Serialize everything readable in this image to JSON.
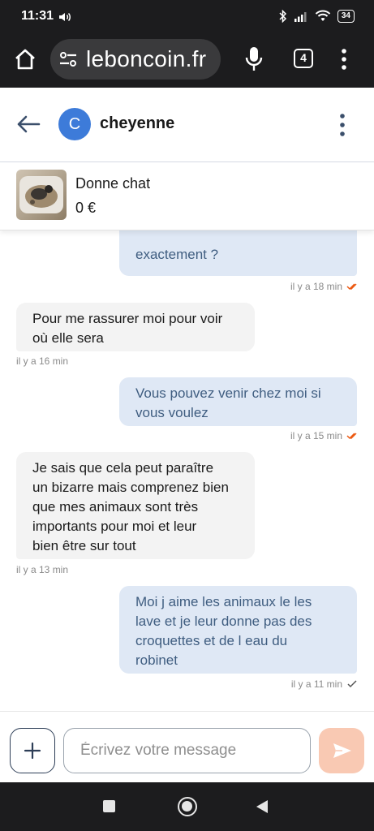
{
  "status_bar": {
    "time": "11:31",
    "battery": "34"
  },
  "browser": {
    "url": "leboncoin.fr",
    "tab_count": "4"
  },
  "header": {
    "avatar_letter": "C",
    "contact_name": "cheyenne"
  },
  "listing": {
    "title": "Donne chat",
    "price": "0 €"
  },
  "messages": [
    {
      "from": "me",
      "lines": [
        "exactement ?"
      ],
      "time": "il y a 18 min",
      "status": "read"
    },
    {
      "from": "them",
      "lines": [
        "Pour me rassurer moi pour voir",
        "où elle sera"
      ],
      "time": "il y a 16 min"
    },
    {
      "from": "me",
      "lines": [
        "Vous pouvez venir chez moi si",
        "vous voulez"
      ],
      "time": "il y a 15 min",
      "status": "read"
    },
    {
      "from": "them",
      "lines": [
        "Je sais que cela peut paraître",
        "un bizarre mais comprenez bien",
        "que mes animaux sont très",
        "importants pour moi et leur",
        "bien être sur tout"
      ],
      "time": "il y a 13 min"
    },
    {
      "from": "me",
      "lines": [
        "Moi j aime les animaux le les",
        "lave et je leur donne pas des",
        "croquettes et de l eau du",
        "robinet"
      ],
      "time": "il y a 11 min",
      "status": "sent"
    }
  ],
  "composer": {
    "placeholder": "Écrivez votre message"
  },
  "colors": {
    "accent_orange": "#ec5a13",
    "send_disabled": "#f9c9b3",
    "my_bubble": "#dfe8f5",
    "their_bubble": "#f3f3f3",
    "avatar_blue": "#3d7bd9"
  }
}
